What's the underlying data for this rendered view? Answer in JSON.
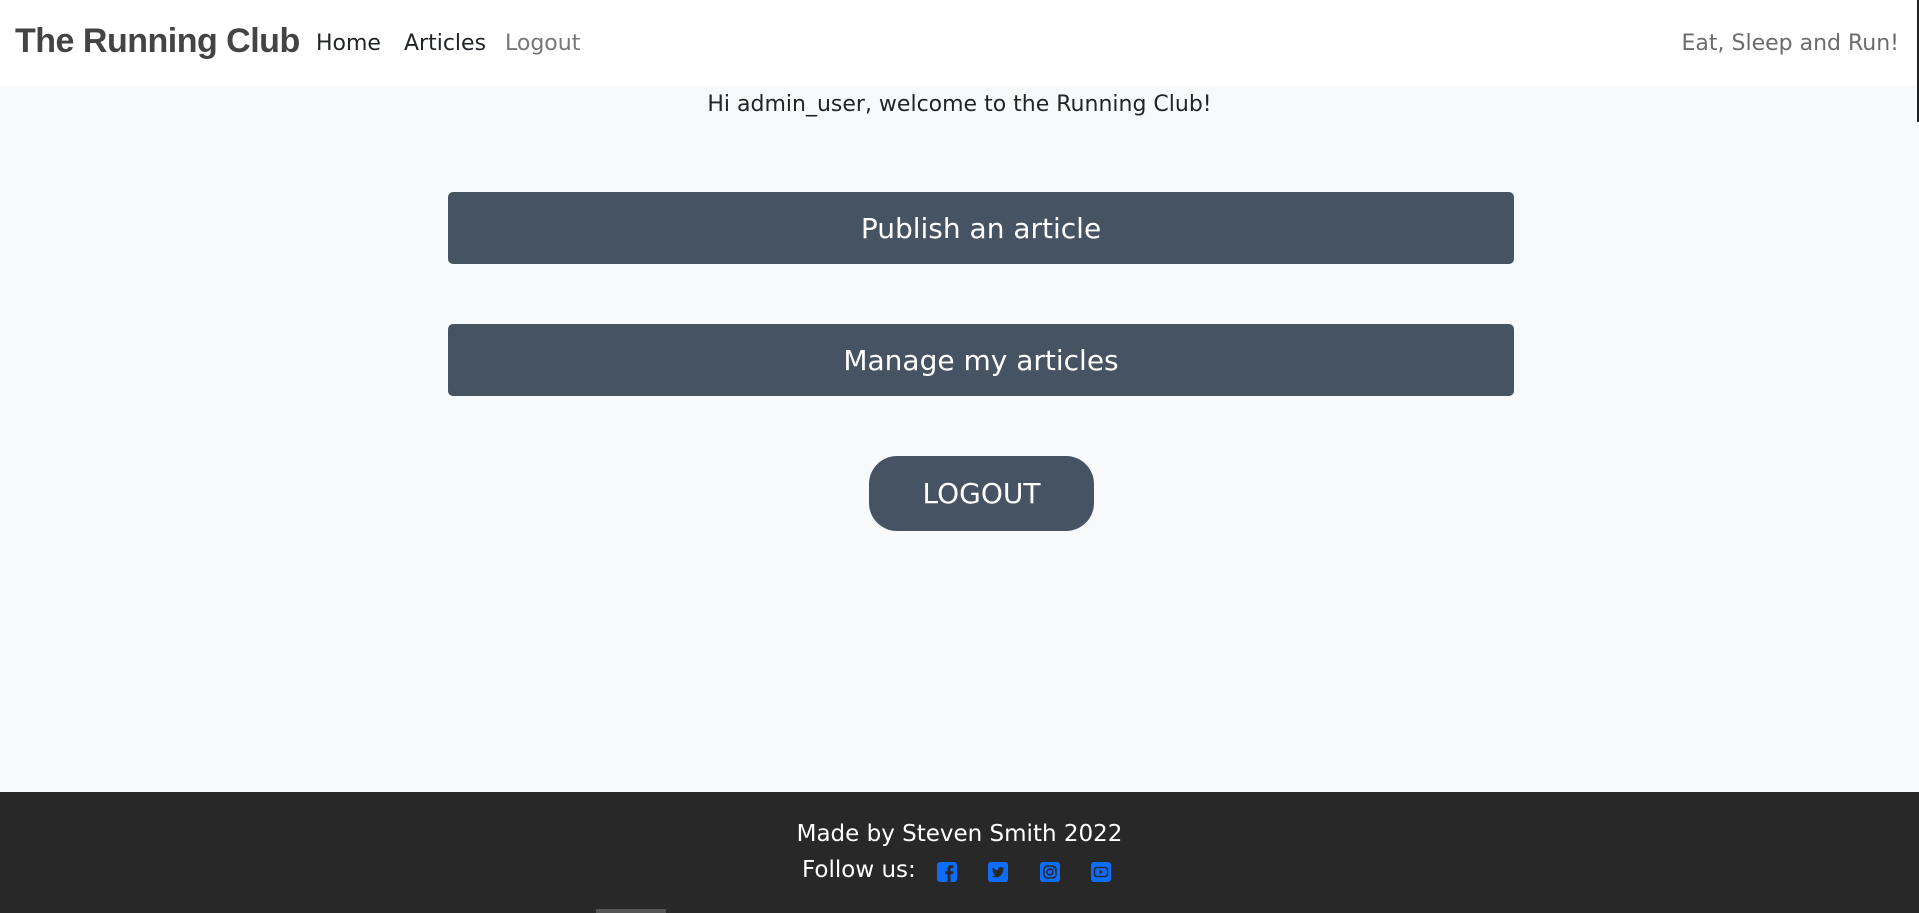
{
  "nav": {
    "brand": "The Running Club",
    "links": [
      "Home",
      "Articles",
      "Logout"
    ],
    "tagline": "Eat, Sleep and Run!"
  },
  "main": {
    "welcome": "Hi admin_user, welcome to the Running Club!",
    "publish_label": "Publish an article",
    "manage_label": "Manage my articles",
    "logout_label": "LOGOUT"
  },
  "footer": {
    "credit": "Made by Steven Smith 2022",
    "follow_label": "Follow us:",
    "social_icons": [
      "facebook-icon",
      "twitter-icon",
      "instagram-icon",
      "youtube-icon"
    ]
  },
  "colors": {
    "button": "#465362",
    "footer_bg": "#282828",
    "social": "#0d6efd",
    "page_bg": "#f8f9fa"
  }
}
